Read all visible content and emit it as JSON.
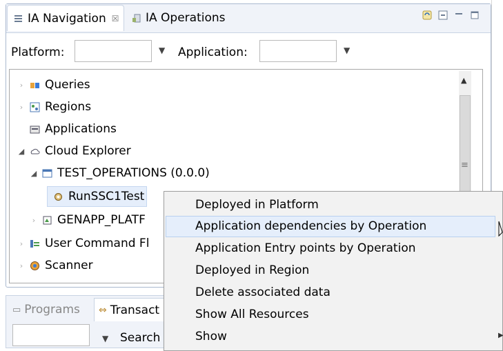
{
  "tabs": {
    "navigation": "IA Navigation",
    "operations": "IA Operations",
    "close_glyph": "☒"
  },
  "filters": {
    "platform_label": "Platform:",
    "platform_value": "",
    "application_label": "Application:",
    "application_value": ""
  },
  "tree": [
    {
      "label": "Queries",
      "icon": "queries-icon"
    },
    {
      "label": "Regions",
      "icon": "regions-icon"
    },
    {
      "label": "Applications",
      "icon": "applications-icon"
    },
    {
      "label": "Cloud Explorer",
      "icon": "cloud-explorer-icon"
    },
    {
      "label": "TEST_OPERATIONS (0.0.0)",
      "icon": "application-node-icon"
    },
    {
      "label": "RunSSC1Test",
      "icon": "gear-icon"
    },
    {
      "label": "GENAPP_PLATF",
      "icon": "platform-node-icon"
    },
    {
      "label": "User Command Fl",
      "icon": "user-command-icon"
    },
    {
      "label": "Scanner",
      "icon": "scanner-icon"
    }
  ],
  "bottom_tabs": {
    "programs": "Programs",
    "transactions": "Transact",
    "search_label": "Search"
  },
  "context_menu": [
    "Deployed in Platform",
    "Application dependencies by Operation",
    "Application Entry points by Operation",
    "Deployed in Region",
    "Delete associated data",
    "Show All Resources",
    "Show"
  ],
  "colors": {
    "tab_bg": "#f0f3f9",
    "selection_bg": "#e5eefb",
    "menu_bg": "#f2f2f2"
  }
}
